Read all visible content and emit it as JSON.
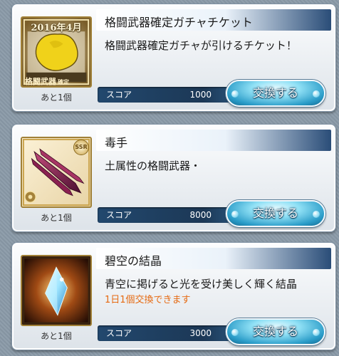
{
  "items": [
    {
      "title": "格闘武器確定ガチャチケット",
      "description": "格闘武器確定ガチャが引けるチケット！",
      "note": "",
      "stock": "あと1個",
      "score_label": "スコア",
      "score_value": "1000",
      "button_label": "交換する",
      "icon": "ticket-icon",
      "stamp_year": "2016年4月",
      "stamp_bottom": "格闘武器",
      "stamp_tag": "確定"
    },
    {
      "title": "毒手",
      "description": "土属性の格闘武器・",
      "note": "",
      "stock": "あと1個",
      "score_label": "スコア",
      "score_value": "8000",
      "button_label": "交換する",
      "icon": "claw-weapon-icon",
      "rarity": "SSR"
    },
    {
      "title": "碧空の結晶",
      "description": "青空に掲げると光を受け美しく輝く結晶",
      "note": "1日1個交換できます",
      "stock": "あと1個",
      "score_label": "スコア",
      "score_value": "3000",
      "button_label": "交換する",
      "icon": "crystal-icon"
    }
  ],
  "colors": {
    "note": "#e66a12",
    "button": "#2a9cc8",
    "score_bar": "#1c3856"
  }
}
